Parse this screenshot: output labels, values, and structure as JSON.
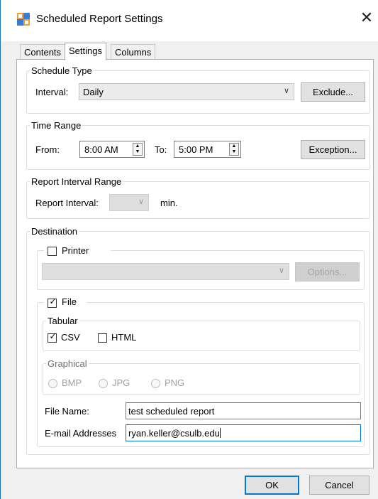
{
  "window": {
    "title": "Scheduled Report Settings",
    "close_glyph": "✕"
  },
  "tabs": [
    {
      "label": "Contents",
      "active": false
    },
    {
      "label": "Settings",
      "active": true
    },
    {
      "label": "Columns",
      "active": false
    }
  ],
  "schedule_type": {
    "legend": "Schedule Type",
    "interval_label": "Interval:",
    "interval_value": "Daily",
    "exclude_button": "Exclude..."
  },
  "time_range": {
    "legend": "Time Range",
    "from_label": "From:",
    "from_value": "8:00 AM",
    "to_label": "To:",
    "to_value": "5:00 PM",
    "exception_button": "Exception..."
  },
  "report_interval_range": {
    "legend": "Report Interval Range",
    "report_interval_label": "Report Interval:",
    "report_interval_value": "",
    "unit_label": "min."
  },
  "destination": {
    "legend": "Destination",
    "printer": {
      "label": "Printer",
      "checked": false,
      "printer_value": "",
      "options_button": "Options..."
    },
    "file": {
      "label": "File",
      "checked": true,
      "tabular": {
        "legend": "Tabular",
        "csv_label": "CSV",
        "csv_checked": true,
        "html_label": "HTML",
        "html_checked": false
      },
      "graphical": {
        "legend": "Graphical",
        "bmp_label": "BMP",
        "jpg_label": "JPG",
        "png_label": "PNG"
      },
      "file_name_label": "File Name:",
      "file_name_value": "test scheduled report",
      "email_label": "E-mail Addresses",
      "email_value": "ryan.keller@csulb.edu"
    }
  },
  "footer": {
    "ok_button": "OK",
    "cancel_button": "Cancel"
  },
  "colors": {
    "accent": "#0078d7",
    "window_border": "#1a73c9",
    "dialog_bg": "#f0f0f0"
  },
  "icons": {
    "app": "report-window-icon",
    "close": "close-icon",
    "dropdown": "chevron-down-icon",
    "spinner": "up-down-spinner-icon",
    "checkmark": "checkmark-icon"
  }
}
